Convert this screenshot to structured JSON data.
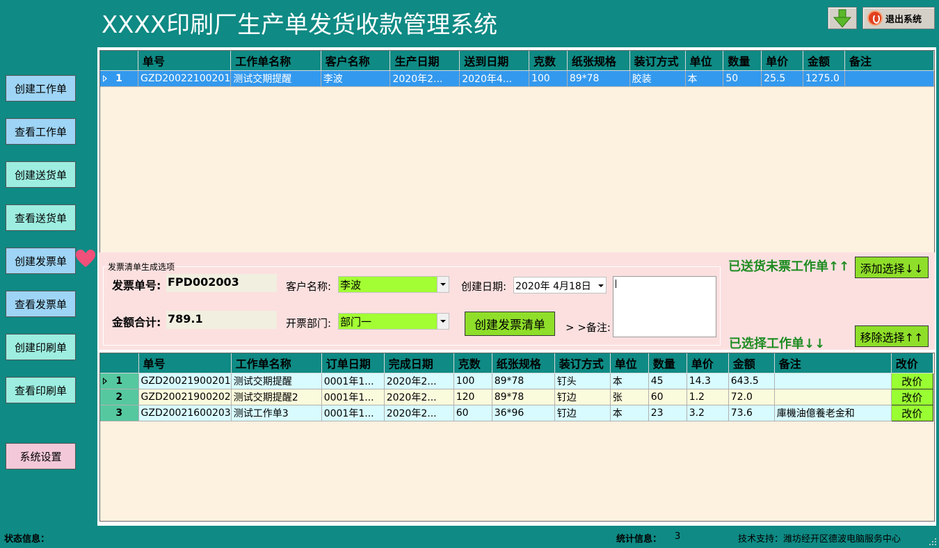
{
  "app": {
    "title": "XXXX印刷厂生产单发货收款管理系统",
    "exit_label": "退出系统"
  },
  "sidebar": {
    "items": [
      {
        "label": "创建工作单"
      },
      {
        "label": "查看工作单"
      },
      {
        "label": "创建送货单"
      },
      {
        "label": "查看送货单"
      },
      {
        "label": "创建发票单"
      },
      {
        "label": "查看发票单"
      },
      {
        "label": "创建印刷单"
      },
      {
        "label": "查看印刷单"
      }
    ],
    "settings_label": "系统设置"
  },
  "top_grid": {
    "columns": [
      "单号",
      "工作单名称",
      "客户名称",
      "生产日期",
      "送到日期",
      "克数",
      "纸张规格",
      "装订方式",
      "单位",
      "数量",
      "单价",
      "金额",
      "备注"
    ],
    "rows": [
      {
        "n": "1",
        "cells": [
          "GZD20022100201",
          "测试交期提醒",
          "李波",
          "2020年2...",
          "2020年4...",
          "100",
          "89*78",
          "胶装",
          "本",
          "50",
          "25.5",
          "1275.0",
          ""
        ]
      }
    ]
  },
  "options": {
    "group_title": "发票清单生成选项",
    "invoice_no_label": "发票单号:",
    "invoice_no_value": "FPD002003",
    "total_label": "金额合计:",
    "total_value": "789.1",
    "customer_label": "客户名称:",
    "customer_value": "李波",
    "dept_label": "开票部门:",
    "dept_value": "部门一",
    "created_label": "创建日期:",
    "created_value": "2020年 4月18日",
    "notes_label": "> >备注:",
    "create_button": "创建发票清单",
    "delivered_label": "已送货未票工作单↑↑",
    "add_button": "添加选择↓↓",
    "selected_label": "已选择工作单↓↓",
    "remove_button": "移除选择↑↑"
  },
  "bottom_grid": {
    "columns": [
      "单号",
      "工作单名称",
      "订单日期",
      "完成日期",
      "克数",
      "纸张规格",
      "装订方式",
      "单位",
      "数量",
      "单价",
      "金额",
      "备注",
      "改价"
    ],
    "rows": [
      {
        "n": "1",
        "cells": [
          "GZD20021900201",
          "测试交期提醒",
          "0001年1...",
          "2020年2...",
          "100",
          "89*78",
          "钉头",
          "本",
          "45",
          "14.3",
          "643.5",
          ""
        ],
        "action": "改价"
      },
      {
        "n": "2",
        "cells": [
          "GZD20021900202",
          "测试交期提醒2",
          "0001年1...",
          "2020年2...",
          "120",
          "89*78",
          "钉边",
          "张",
          "60",
          "1.2",
          "72.0",
          ""
        ],
        "action": "改价"
      },
      {
        "n": "3",
        "cells": [
          "GZD20021600203",
          "测试工作单3",
          "0001年1...",
          "2020年2...",
          "60",
          "36*96",
          "钉边",
          "本",
          "23",
          "3.2",
          "73.6",
          "庫機油億養老金和"
        ],
        "action": "改价"
      }
    ]
  },
  "status": {
    "state_label": "状态信息：",
    "stats_label": "统计信息：",
    "stats_value": "3",
    "support": "技术支持：潍坊经开区德波电脑服务中心"
  },
  "colors": {
    "background": "#0f8a84",
    "selection": "#3399ee",
    "accent_green": "#8fde2a"
  }
}
